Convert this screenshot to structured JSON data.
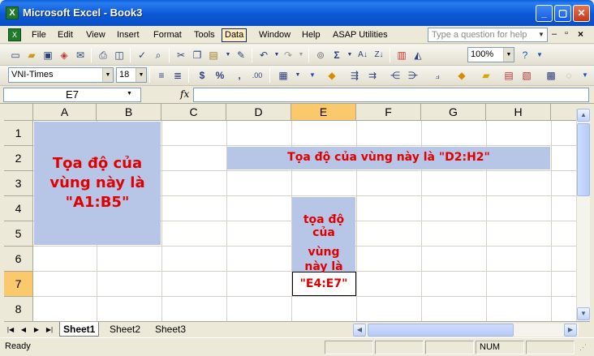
{
  "window": {
    "title": "Microsoft Excel - Book3",
    "app_icon": "X"
  },
  "menu": {
    "items": [
      "File",
      "Edit",
      "View",
      "Insert",
      "Format",
      "Tools",
      "Data",
      "Window",
      "Help",
      "ASAP Utilities"
    ],
    "active": "Data",
    "help_placeholder": "Type a question for help"
  },
  "toolbar": {
    "zoom": "100%",
    "font": "VNI-Times",
    "size": "18"
  },
  "formula_bar": {
    "name_box": "E7",
    "fx": "fx",
    "formula": ""
  },
  "grid": {
    "columns": [
      "A",
      "B",
      "C",
      "D",
      "E",
      "F",
      "G",
      "H"
    ],
    "rows": [
      "1",
      "2",
      "3",
      "4",
      "5",
      "6",
      "7",
      "8"
    ],
    "selected_column": "E",
    "selected_row": "7"
  },
  "ranges": {
    "a1b5": "Tọa độ của vùng này là \"A1:B5\"",
    "d2h2": "Tọa độ của vùng này là \"D2:H2\"",
    "e4e7_lines": [
      "tọa độ",
      "của",
      "vùng",
      "này là",
      "\"E4:E7\""
    ]
  },
  "tabs": {
    "sheets": [
      "Sheet1",
      "Sheet2",
      "Sheet3"
    ],
    "active": "Sheet1"
  },
  "status": {
    "mode": "Ready",
    "num": "NUM"
  },
  "colors": {
    "titlebar": "#0a5fd8",
    "range_fill": "#b7c6e6",
    "range_text": "#e00000",
    "header_selected": "#f9c96b"
  }
}
